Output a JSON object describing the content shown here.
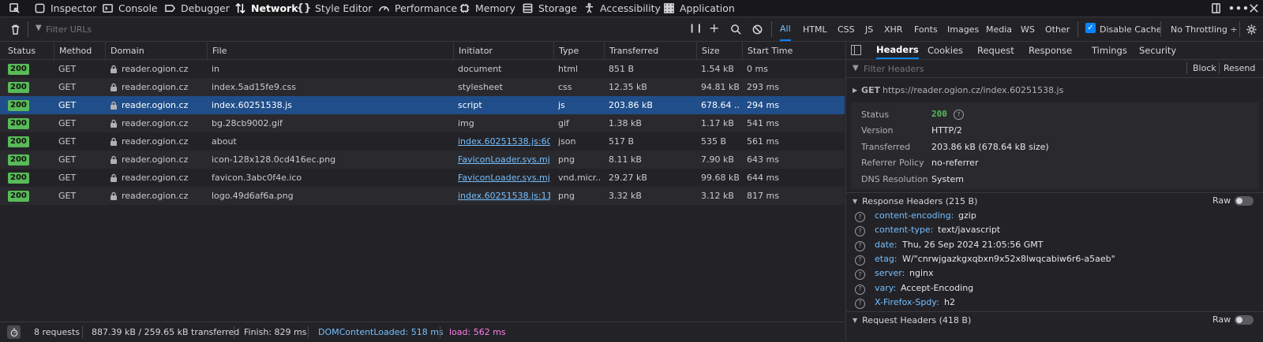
{
  "toolbox": {
    "tabs": [
      "Inspector",
      "Console",
      "Debugger",
      "Network",
      "Style Editor",
      "Performance",
      "Memory",
      "Storage",
      "Accessibility",
      "Application"
    ],
    "selected": "Network",
    "more": "•••"
  },
  "filterbar": {
    "placeholder": "Filter URLs",
    "types": [
      "All",
      "HTML",
      "CSS",
      "JS",
      "XHR",
      "Fonts",
      "Images",
      "Media",
      "WS",
      "Other"
    ],
    "active_type": "All",
    "disable_cache": "Disable Cache",
    "throttling": "No Throttling ÷"
  },
  "columns": [
    "Status",
    "Method",
    "Domain",
    "File",
    "Initiator",
    "Type",
    "Transferred",
    "Size",
    "Start Time"
  ],
  "requests": [
    {
      "status": "200",
      "method": "GET",
      "domain": "reader.ogion.cz",
      "file": "in",
      "initiator": "document",
      "type": "html",
      "transferred": "851 B",
      "size": "1.54 kB",
      "start": "0 ms"
    },
    {
      "status": "200",
      "method": "GET",
      "domain": "reader.ogion.cz",
      "file": "index.5ad15fe9.css",
      "initiator": "stylesheet",
      "type": "css",
      "transferred": "12.35 kB",
      "size": "94.81 kB",
      "start": "293 ms"
    },
    {
      "status": "200",
      "method": "GET",
      "domain": "reader.ogion.cz",
      "file": "index.60251538.js",
      "initiator": "script",
      "type": "js",
      "transferred": "203.86 kB",
      "size": "678.64 ...",
      "start": "294 ms"
    },
    {
      "status": "200",
      "method": "GET",
      "domain": "reader.ogion.cz",
      "file": "bg.28cb9002.gif",
      "initiator": "img",
      "type": "gif",
      "transferred": "1.38 kB",
      "size": "1.17 kB",
      "start": "541 ms"
    },
    {
      "status": "200",
      "method": "GET",
      "domain": "reader.ogion.cz",
      "file": "about",
      "initiator": "index.60251538.js:60...",
      "type": "json",
      "transferred": "517 B",
      "size": "535 B",
      "start": "561 ms"
    },
    {
      "status": "200",
      "method": "GET",
      "domain": "reader.ogion.cz",
      "file": "icon-128x128.0cd416ec.png",
      "initiator": "FaviconLoader.sys.mjs...",
      "type": "png",
      "transferred": "8.11 kB",
      "size": "7.90 kB",
      "start": "643 ms"
    },
    {
      "status": "200",
      "method": "GET",
      "domain": "reader.ogion.cz",
      "file": "favicon.3abc0f4e.ico",
      "initiator": "FaviconLoader.sys.mjs...",
      "type": "vnd.micr...",
      "transferred": "29.27 kB",
      "size": "99.68 kB",
      "start": "644 ms"
    },
    {
      "status": "200",
      "method": "GET",
      "domain": "reader.ogion.cz",
      "file": "logo.49d6af6a.png",
      "initiator": "index.60251538.js:11...",
      "type": "png",
      "transferred": "3.32 kB",
      "size": "3.12 kB",
      "start": "817 ms"
    }
  ],
  "statusbar": {
    "requests": "8 requests",
    "sizes": "887.39 kB / 259.65 kB transferred",
    "finish": "Finish: 829 ms",
    "domcontent": "DOMContentLoaded: 518 ms",
    "load": "load: 562 ms"
  },
  "details": {
    "tabs": [
      "Headers",
      "Cookies",
      "Request",
      "Response",
      "Timings",
      "Security"
    ],
    "active_tab": "Headers",
    "filter_placeholder": "Filter Headers",
    "block": "Block",
    "resend": "Resend",
    "summary_method": "GET",
    "summary_url": "https://reader.ogion.cz/index.60251538.js",
    "status_label": "Status",
    "status_value": "200",
    "version_label": "Version",
    "version_value": "HTTP/2",
    "transferred_label": "Transferred",
    "transferred_value": "203.86 kB (678.64 kB size)",
    "referrer_label": "Referrer Policy",
    "referrer_value": "no-referrer",
    "dns_label": "DNS Resolution",
    "dns_value": "System",
    "response_headers_title": "Response Headers (215 B)",
    "raw": "Raw",
    "response_headers": [
      {
        "name": "content-encoding:",
        "value": "gzip"
      },
      {
        "name": "content-type:",
        "value": "text/javascript"
      },
      {
        "name": "date:",
        "value": "Thu, 26 Sep 2024 21:05:56 GMT"
      },
      {
        "name": "etag:",
        "value": "W/\"cnrwjgazkgxqbxn9x52x8lwqcabiw6r6-a5aeb\""
      },
      {
        "name": "server:",
        "value": "nginx"
      },
      {
        "name": "vary:",
        "value": "Accept-Encoding"
      },
      {
        "name": "X-Firefox-Spdy:",
        "value": "h2"
      }
    ],
    "request_headers_title": "Request Headers (418 B)"
  },
  "colors": {
    "accent": "#0a84ff",
    "link": "#75bfff",
    "badge": "#58ba58",
    "selected_row": "#204e8a",
    "domcontent": "#75bfff",
    "load": "#ff7de9"
  }
}
